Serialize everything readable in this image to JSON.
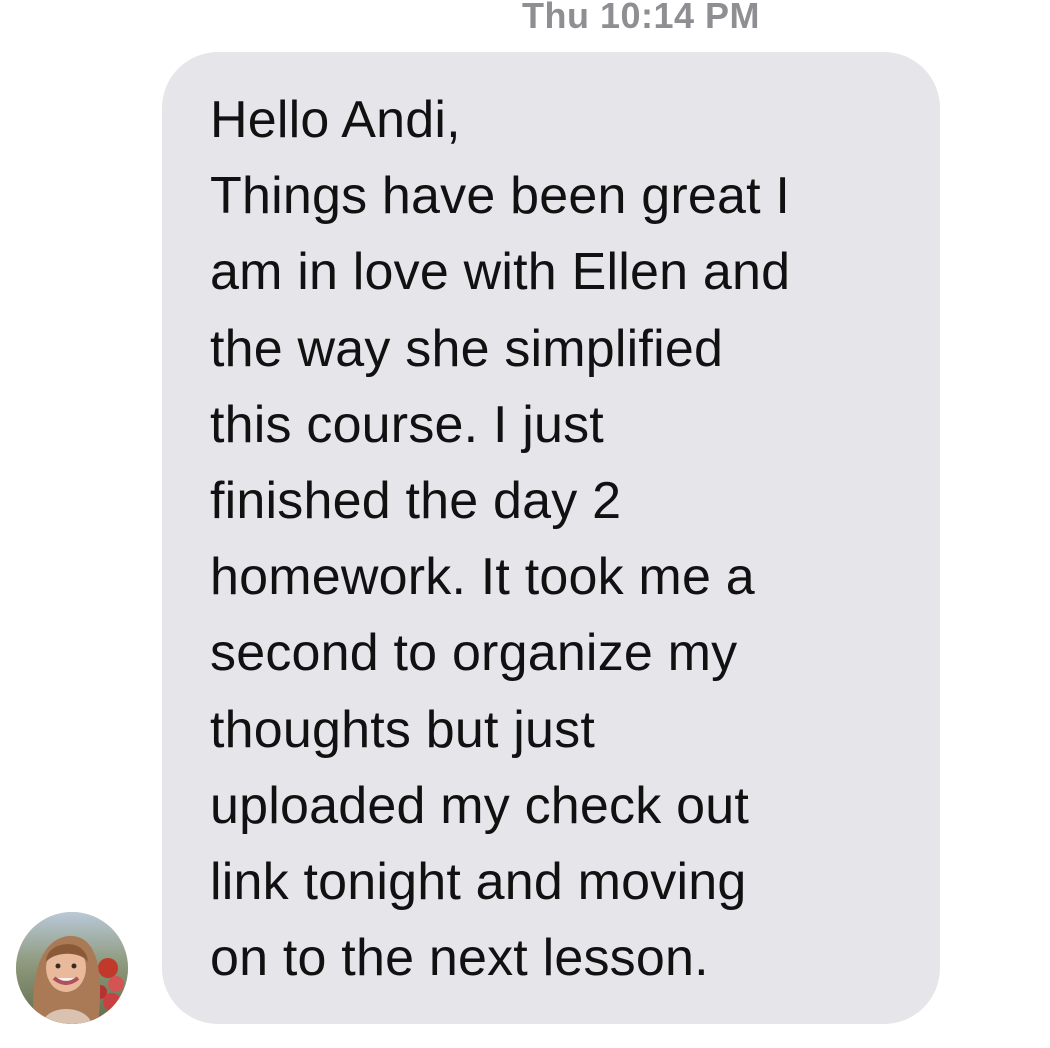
{
  "conversation": {
    "timestamp": "Thu 10:14 PM",
    "message": {
      "lines": [
        "Hello Andi,",
        "Things have been great I",
        "am in love with Ellen and",
        "the way she simplified",
        "this course. I just",
        "finished the day 2",
        "homework. It took me a",
        "second to organize my",
        "thoughts but just",
        "uploaded my check out",
        "link tonight and moving",
        "on to the next lesson."
      ]
    },
    "sender": {
      "avatar_icon": "profile-photo"
    }
  },
  "colors": {
    "bubble": "#e5e5ea",
    "timestamp": "#8e8e93",
    "text": "#111111"
  }
}
